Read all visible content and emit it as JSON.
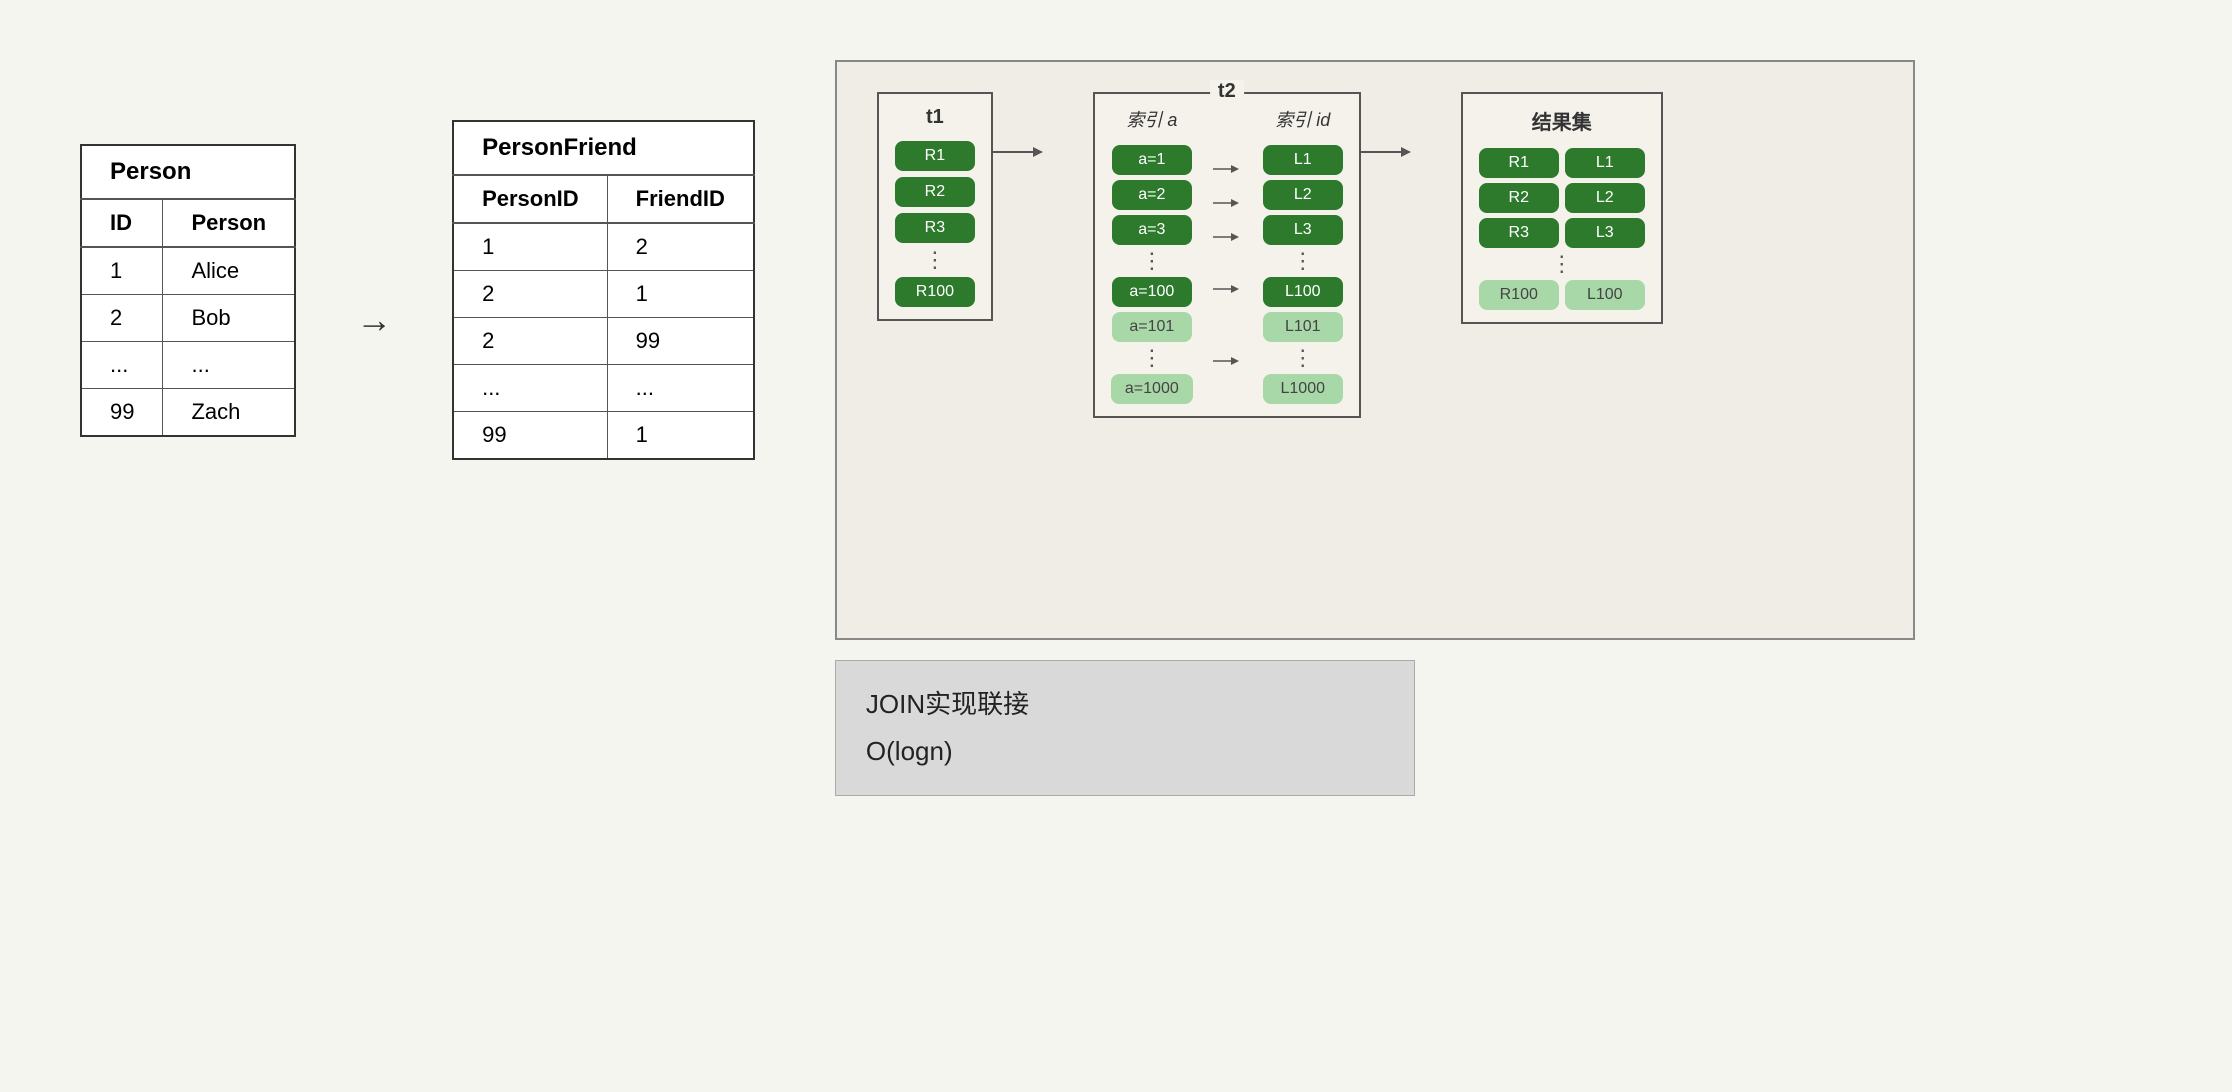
{
  "person_table": {
    "title": "Person",
    "headers": [
      "ID",
      "Person"
    ],
    "rows": [
      [
        "1",
        "Alice"
      ],
      [
        "2",
        "Bob"
      ],
      [
        "...",
        "..."
      ],
      [
        "99",
        "Zach"
      ]
    ]
  },
  "person_friend_table": {
    "title": "PersonFriend",
    "headers": [
      "PersonID",
      "FriendID"
    ],
    "rows": [
      [
        "1",
        "2"
      ],
      [
        "2",
        "1"
      ],
      [
        "2",
        "99"
      ],
      [
        "...",
        "..."
      ],
      [
        "99",
        "1"
      ]
    ]
  },
  "diagram": {
    "t1_label": "t1",
    "t2_label": "t2",
    "index_a_label": "索引 a",
    "index_id_label": "索引 id",
    "result_label": "结果集",
    "t1_rows_dark": [
      "R1",
      "R2",
      "R3",
      "R100"
    ],
    "t1_rows_light": [],
    "t1_dot": "⋮",
    "index_a_dark": [
      "a=1",
      "a=2",
      "a=3",
      "a=100"
    ],
    "index_a_light": [
      "a=101",
      "a=1000"
    ],
    "index_a_dot": "⋮",
    "index_id_dark": [
      "L1",
      "L2",
      "L3",
      "L100"
    ],
    "index_id_light": [
      "L101",
      "L1000"
    ],
    "index_id_dot": "⋮",
    "result_dark": [
      [
        "R1",
        "L1"
      ],
      [
        "R2",
        "L2"
      ],
      [
        "R3",
        "L3"
      ],
      [
        "R100",
        "L100"
      ]
    ],
    "result_dot": "⋮"
  },
  "caption": {
    "line1": "JOIN实现联接",
    "line2": "O(logn)"
  }
}
